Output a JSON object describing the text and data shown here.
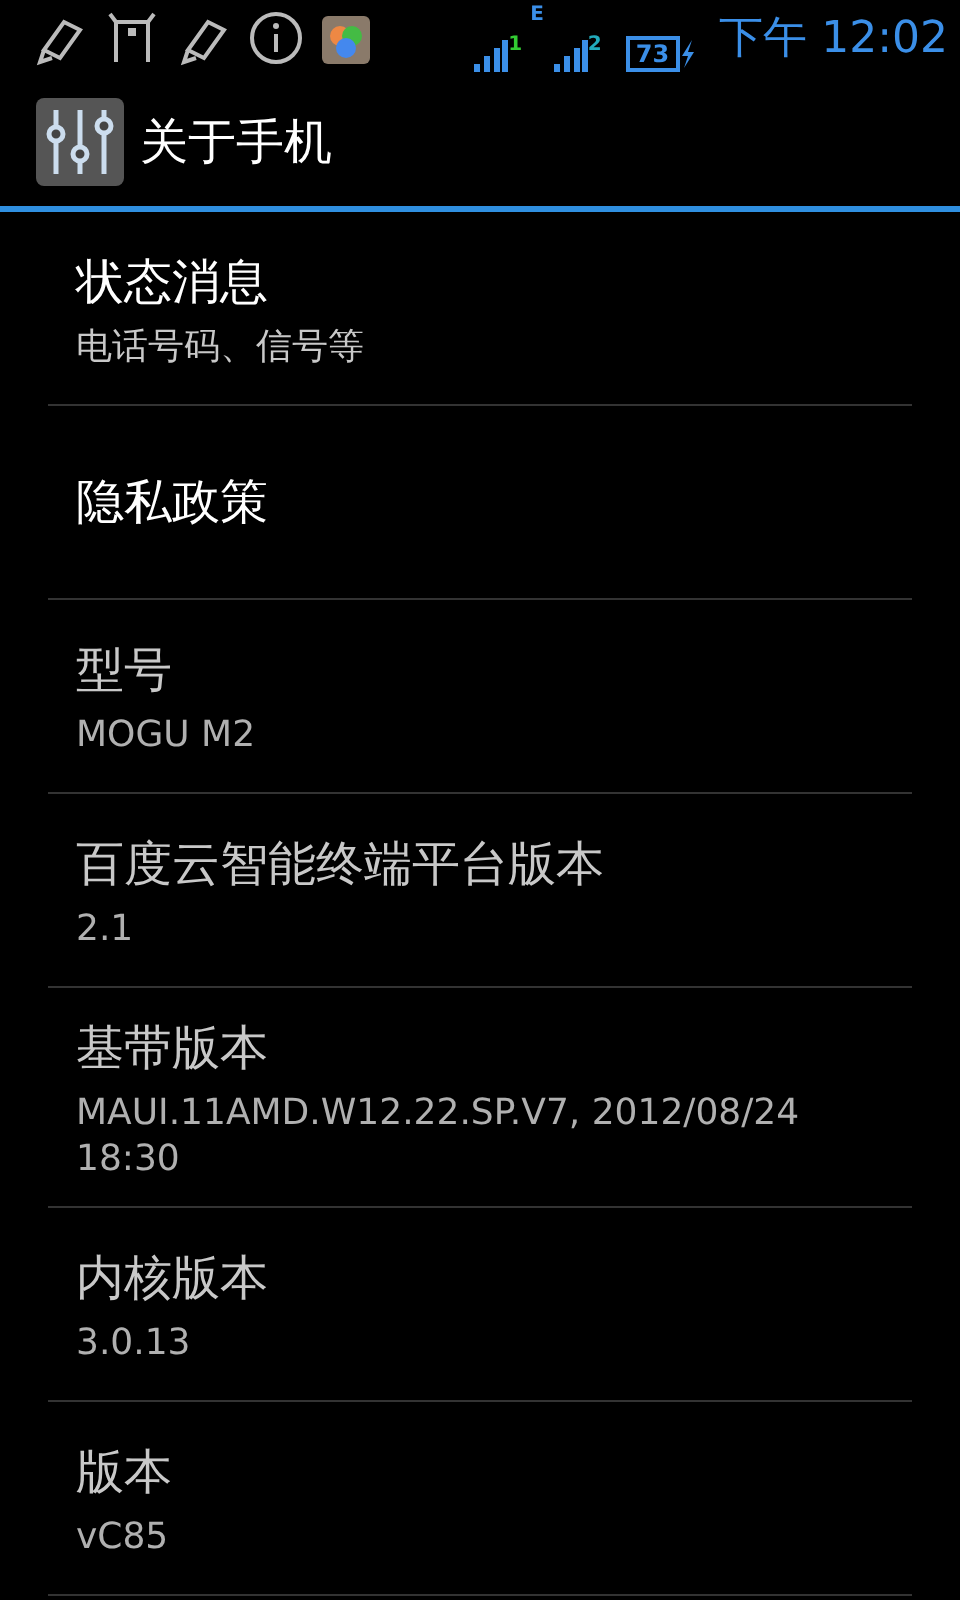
{
  "status_bar": {
    "sim1_label": "1",
    "network_type": "E",
    "sim2_label": "2",
    "battery": "73",
    "charging": true,
    "time": "下午 12:02"
  },
  "title_bar": {
    "title": "关于手机"
  },
  "items": [
    {
      "kind": "link",
      "title": "状态消息",
      "summary": "电话号码、信号等"
    },
    {
      "kind": "link",
      "title": "隐私政策"
    },
    {
      "kind": "info",
      "title": "型号",
      "summary": "MOGU M2"
    },
    {
      "kind": "info",
      "title": "百度云智能终端平台版本",
      "summary": "2.1"
    },
    {
      "kind": "info",
      "title": "基带版本",
      "summary": "MAUI.11AMD.W12.22.SP.V7, 2012/08/24 18:30"
    },
    {
      "kind": "info",
      "title": "内核版本",
      "summary": "3.0.13"
    },
    {
      "kind": "info",
      "title": "版本",
      "summary": "vC85"
    }
  ]
}
